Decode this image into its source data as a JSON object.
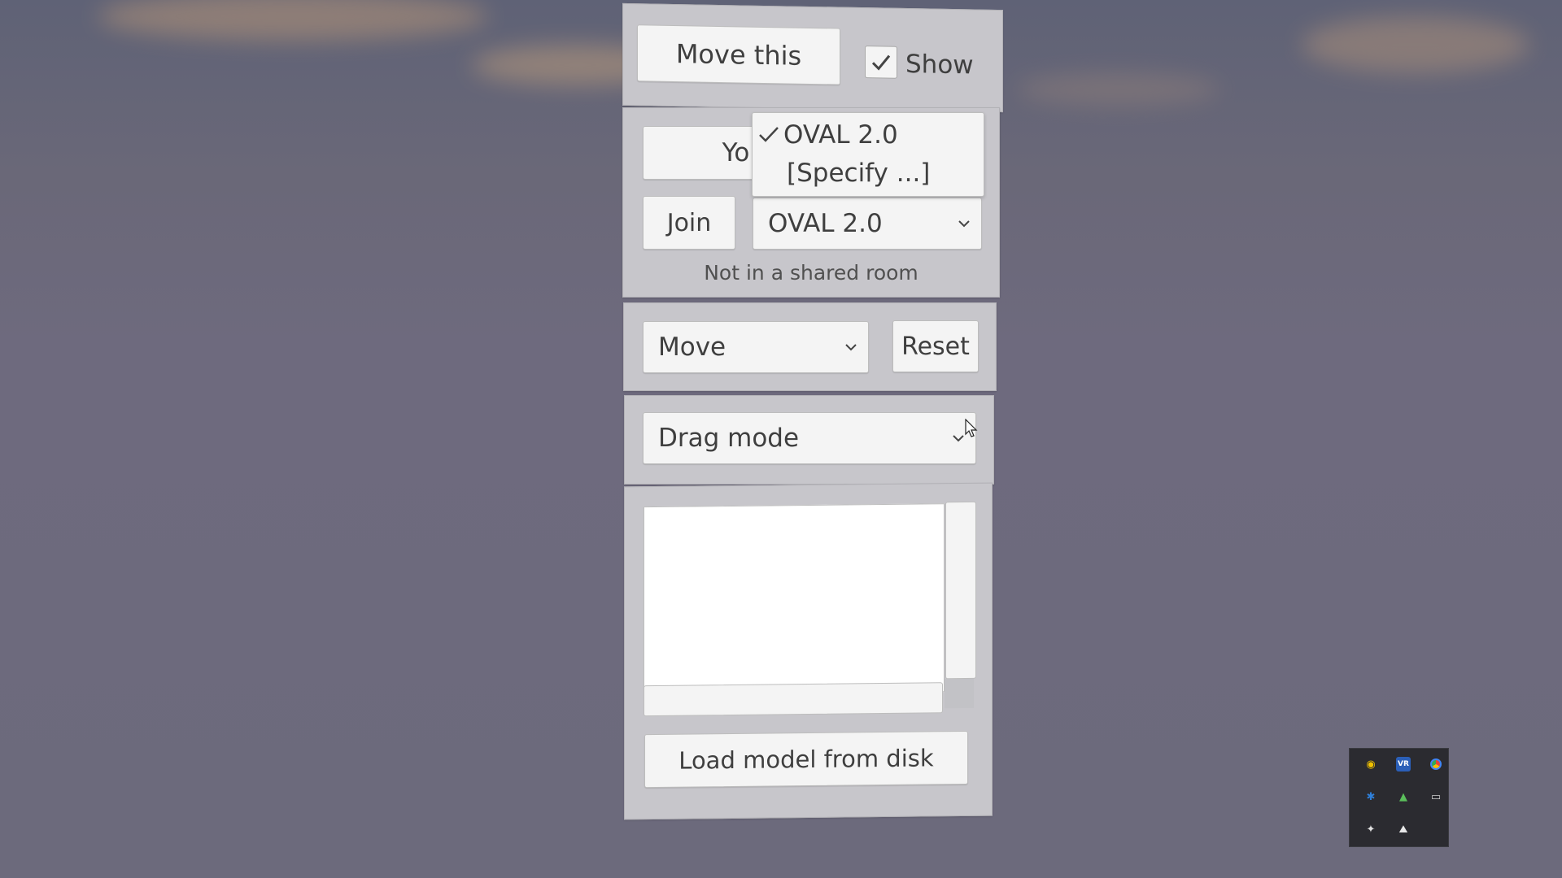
{
  "top_bar": {
    "move_button_label": "Move this",
    "show_checkbox_label": "Show",
    "show_checked": true
  },
  "room": {
    "you_button_label": "You",
    "join_button_label": "Join",
    "room_dropdown_value": "OVAL 2.0",
    "status_text": "Not in a shared room",
    "dropdown_menu": {
      "items": [
        {
          "label": "OVAL 2.0",
          "checked": true
        },
        {
          "label": "[Specify ...]",
          "checked": false
        }
      ]
    }
  },
  "transform": {
    "mode_dropdown_value": "Move",
    "reset_button_label": "Reset"
  },
  "drag": {
    "drag_mode_dropdown_value": "Drag mode"
  },
  "models": {
    "load_button_label": "Load model from disk"
  },
  "tray": {
    "icons": [
      "headset-icon",
      "vr-icon",
      "chrome-icon",
      "bluetooth-icon",
      "shield-icon",
      "display-icon",
      "slack-icon",
      "docker-icon"
    ]
  },
  "colors": {
    "panel": "#c7c6cb",
    "button": "#f4f4f4",
    "text": "#3f3f3f",
    "tray_bg": "#2b2b30"
  }
}
